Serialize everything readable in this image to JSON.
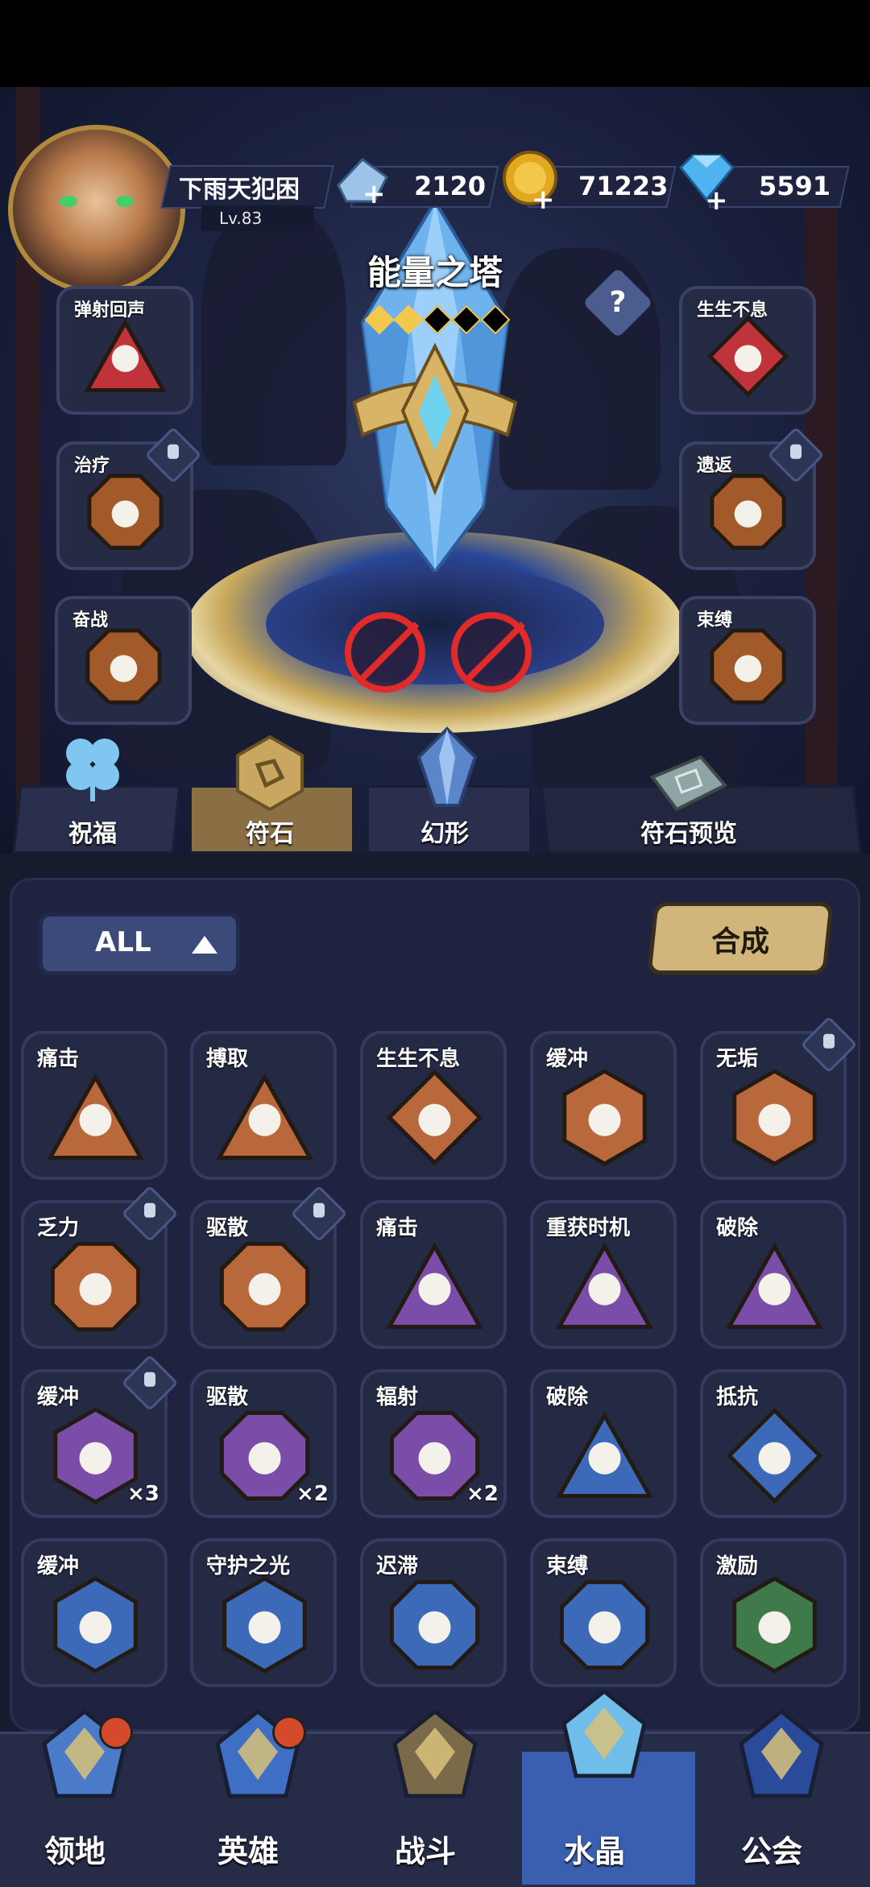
{
  "player": {
    "name": "下雨天犯困",
    "level": "Lv.83"
  },
  "resources": [
    {
      "icon": "ice-shard-icon",
      "value": "2120"
    },
    {
      "icon": "gold-coin-icon",
      "value": "71223"
    },
    {
      "icon": "diamond-icon",
      "value": "5591"
    }
  ],
  "tower": {
    "title": "能量之塔",
    "help": "?",
    "stars_filled": 2,
    "stars_total": 5
  },
  "left_slots": [
    {
      "label": "弹射回声",
      "locked": false,
      "color": "#c0333a"
    },
    {
      "label": "治疗",
      "locked": true,
      "color": "#a35a2a"
    },
    {
      "label": "奋战",
      "locked": false,
      "color": "#a35a2a"
    }
  ],
  "right_slots": [
    {
      "label": "生生不息",
      "locked": false,
      "color": "#c0333a"
    },
    {
      "label": "遗返",
      "locked": true,
      "color": "#a35a2a"
    },
    {
      "label": "束缚",
      "locked": false,
      "color": "#a35a2a"
    }
  ],
  "tabs": [
    {
      "label": "祝福",
      "icon": "clover-icon"
    },
    {
      "label": "符石",
      "icon": "rune-stone-icon",
      "active": true
    },
    {
      "label": "幻形",
      "icon": "crystal-icon"
    },
    {
      "label": "符石预览",
      "icon": "rune-book-icon"
    }
  ],
  "filter": {
    "label": "ALL"
  },
  "synth_button": "合成",
  "runes": [
    {
      "label": "痛击",
      "shape": "triangle",
      "color": "#b8683a",
      "lock": false,
      "count": ""
    },
    {
      "label": "搏取",
      "shape": "triangle",
      "color": "#b8683a",
      "lock": false,
      "count": ""
    },
    {
      "label": "生生不息",
      "shape": "diamond",
      "color": "#b8683a",
      "lock": false,
      "count": ""
    },
    {
      "label": "缓冲",
      "shape": "hexagon",
      "color": "#b8683a",
      "lock": false,
      "count": ""
    },
    {
      "label": "无垢",
      "shape": "hexagon",
      "color": "#b8683a",
      "lock": true,
      "count": ""
    },
    {
      "label": "乏力",
      "shape": "octagon",
      "color": "#b8683a",
      "lock": true,
      "count": ""
    },
    {
      "label": "驱散",
      "shape": "octagon",
      "color": "#b8683a",
      "lock": true,
      "count": ""
    },
    {
      "label": "痛击",
      "shape": "triangle",
      "color": "#7a4ea8",
      "lock": false,
      "count": ""
    },
    {
      "label": "重获时机",
      "shape": "triangle",
      "color": "#7a4ea8",
      "lock": false,
      "count": ""
    },
    {
      "label": "破除",
      "shape": "triangle",
      "color": "#7a4ea8",
      "lock": false,
      "count": ""
    },
    {
      "label": "缓冲",
      "shape": "hexagon",
      "color": "#7a4ea8",
      "lock": true,
      "count": "×3"
    },
    {
      "label": "驱散",
      "shape": "octagon",
      "color": "#7a4ea8",
      "lock": false,
      "count": "×2"
    },
    {
      "label": "辐射",
      "shape": "octagon",
      "color": "#7a4ea8",
      "lock": false,
      "count": "×2"
    },
    {
      "label": "破除",
      "shape": "triangle",
      "color": "#3c6ab8",
      "lock": false,
      "count": ""
    },
    {
      "label": "抵抗",
      "shape": "diamond",
      "color": "#3c6ab8",
      "lock": false,
      "count": ""
    },
    {
      "label": "缓冲",
      "shape": "hexagon",
      "color": "#3c6ab8",
      "lock": false,
      "count": ""
    },
    {
      "label": "守护之光",
      "shape": "hexagon",
      "color": "#3c6ab8",
      "lock": false,
      "count": ""
    },
    {
      "label": "迟滞",
      "shape": "octagon",
      "color": "#3c6ab8",
      "lock": false,
      "count": ""
    },
    {
      "label": "束缚",
      "shape": "octagon",
      "color": "#3c6ab8",
      "lock": false,
      "count": ""
    },
    {
      "label": "激励",
      "shape": "hexagon",
      "color": "#3f7a4a",
      "lock": false,
      "count": ""
    }
  ],
  "nav": [
    {
      "label": "领地",
      "icon": "castle-icon",
      "badge": true
    },
    {
      "label": "英雄",
      "icon": "hero-hat-icon",
      "badge": true
    },
    {
      "label": "战斗",
      "icon": "battle-icon",
      "badge": false
    },
    {
      "label": "水晶",
      "icon": "crystal-nav-icon",
      "badge": false,
      "active": true
    },
    {
      "label": "公会",
      "icon": "guild-banner-icon",
      "badge": false
    }
  ]
}
